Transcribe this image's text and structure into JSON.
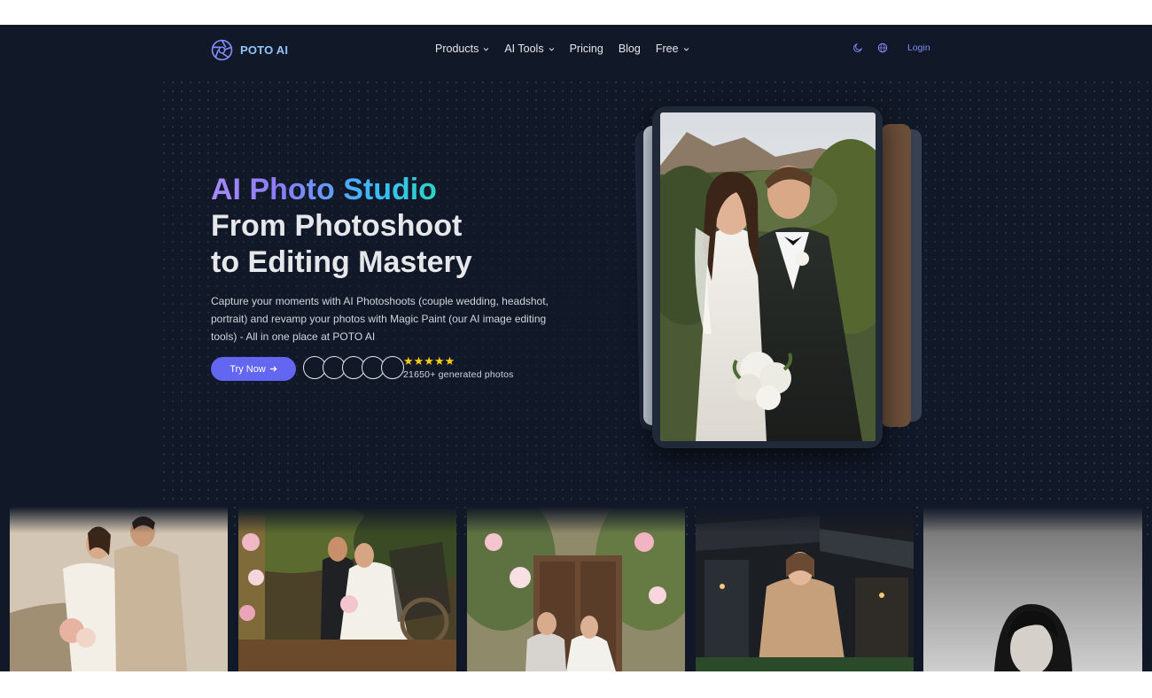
{
  "brand": {
    "name": "POTO AI"
  },
  "nav": {
    "items": [
      {
        "label": "Products",
        "has_dropdown": true
      },
      {
        "label": "AI Tools",
        "has_dropdown": true
      },
      {
        "label": "Pricing",
        "has_dropdown": false
      },
      {
        "label": "Blog",
        "has_dropdown": false
      },
      {
        "label": "Free",
        "has_dropdown": true
      }
    ],
    "icons": [
      "moon-icon",
      "globe-icon"
    ],
    "login_label": "Login"
  },
  "hero": {
    "title_gradient": "AI Photo Studio",
    "title_line2": "From Photoshoot",
    "title_line3": "to Editing Mastery",
    "description": "Capture your moments with AI Photoshoots (couple wedding, headshot, portrait) and revamp your photos with Magic Paint (our AI image editing tools) - All in one place at POTO AI",
    "cta_label": "Try Now",
    "cta_icon": "arrow-right-icon",
    "rating_stars": "★★★★★",
    "rating": 5,
    "generated_text": "21650+ generated photos"
  },
  "colors": {
    "background": "#111827",
    "accent": "#6366f1",
    "brand": "#93c5fd",
    "star": "#facc15",
    "gradient_start": "#a78bfa",
    "gradient_end": "#2dd4bf"
  }
}
